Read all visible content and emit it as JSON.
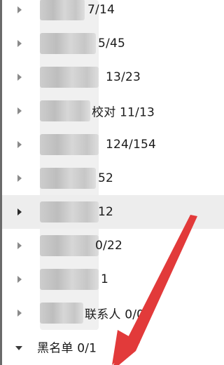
{
  "groups": [
    {
      "label": "7/14",
      "expanded": false
    },
    {
      "label": "5/45",
      "expanded": false
    },
    {
      "label": "13/23",
      "expanded": false
    },
    {
      "label": "校对 11/13",
      "expanded": false
    },
    {
      "label": "124/154",
      "expanded": false
    },
    {
      "label": "52",
      "expanded": false
    },
    {
      "label": "12",
      "expanded": false,
      "hovered": true
    },
    {
      "label": "0/22",
      "expanded": false
    },
    {
      "label": "1",
      "expanded": false
    },
    {
      "label": "联系人 0/0",
      "expanded": false
    },
    {
      "label": "黑名单 0/1",
      "expanded": true
    }
  ],
  "colors": {
    "annotation_arrow": "#e23a3a",
    "hover_row": "#ededed"
  },
  "icons": {
    "collapsed": "caret-right-icon",
    "expanded": "caret-down-icon"
  }
}
